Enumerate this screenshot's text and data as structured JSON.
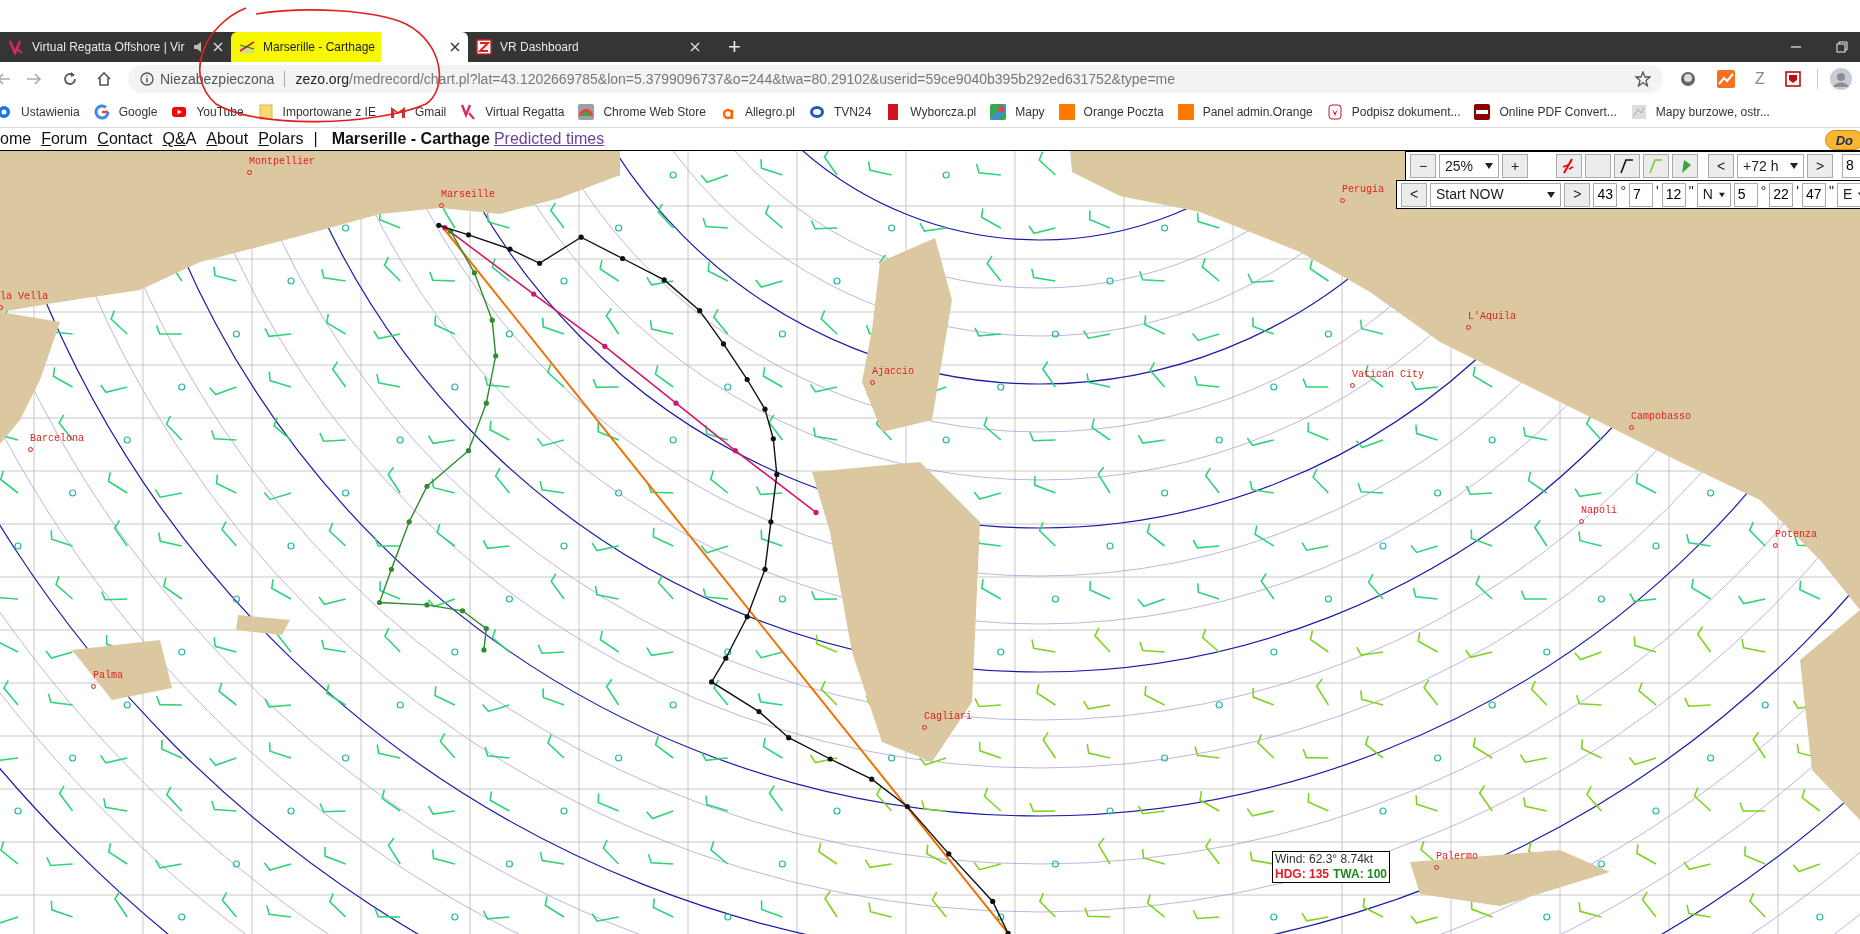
{
  "tabs": [
    {
      "title": "Virtual Regatta Offshore | Vir",
      "selected": false,
      "audio": true
    },
    {
      "title": "Marserille - Carthage",
      "selected": true,
      "audio": false
    },
    {
      "title": "VR Dashboard",
      "selected": false,
      "audio": false
    }
  ],
  "new_tab": "+",
  "address": {
    "security": "Niezabezpieczona",
    "host": "zezo.org",
    "path": "/medrecord/chart.pl?lat=43.1202669785&lon=5.3799096737&o=244&twa=80.29102&userid=59ce9040b395b292ed631752&type=me"
  },
  "extension_label": "Z",
  "bookmarks": [
    "Ustawienia",
    "Google",
    "YouTube",
    "Importowane z IE",
    "Gmail",
    "Virtual Regatta",
    "Chrome Web Store",
    "Allegro.pl",
    "TVN24",
    "Wyborcza.pl",
    "Mapy",
    "Orange Poczta",
    "Panel admin.Orange",
    "Podpisz dokument...",
    "Online PDF Convert...",
    "Mapy burzowe, ostr..."
  ],
  "nav": {
    "links": [
      "ome",
      "Forum",
      "Contact",
      "Q&A",
      "About",
      "Polars"
    ],
    "separator": "|",
    "title": "Marserille - Carthage",
    "predicted": "Predicted times"
  },
  "donate": "Do",
  "controls": {
    "zoom_minus": "−",
    "zoom": "25%",
    "zoom_plus": "+",
    "forecast_prev": "<",
    "forecast": "+72 h",
    "forecast_next": ">",
    "cut": "8",
    "start_prev": "<",
    "start": "Start NOW",
    "start_next": ">",
    "position": [
      {
        "value": "43"
      },
      {
        "sign": "°"
      },
      {
        "value": "7"
      },
      {
        "sign": "'"
      },
      {
        "value": "12"
      },
      {
        "sign": "\""
      },
      {
        "select": "N"
      },
      {
        "value": "5"
      },
      {
        "sign": "°"
      },
      {
        "value": "22"
      },
      {
        "sign": "'"
      },
      {
        "value": "47"
      },
      {
        "sign": "\""
      },
      {
        "select": "E"
      }
    ]
  },
  "map": {
    "cities": [
      "Montpellier",
      "Marseille",
      "Perugia",
      "la Vella",
      "L'Aquila",
      "Ajaccio",
      "Vatican City",
      "Barcelona",
      "Campobasso",
      "Napoli",
      "Potenza",
      "Palma",
      "Cagliari",
      "Palermo"
    ]
  },
  "tooltip": {
    "wind": "Wind: 62.3° 8.74kt",
    "hdg": "HDG: 135",
    "twa": "TWA: 100"
  }
}
